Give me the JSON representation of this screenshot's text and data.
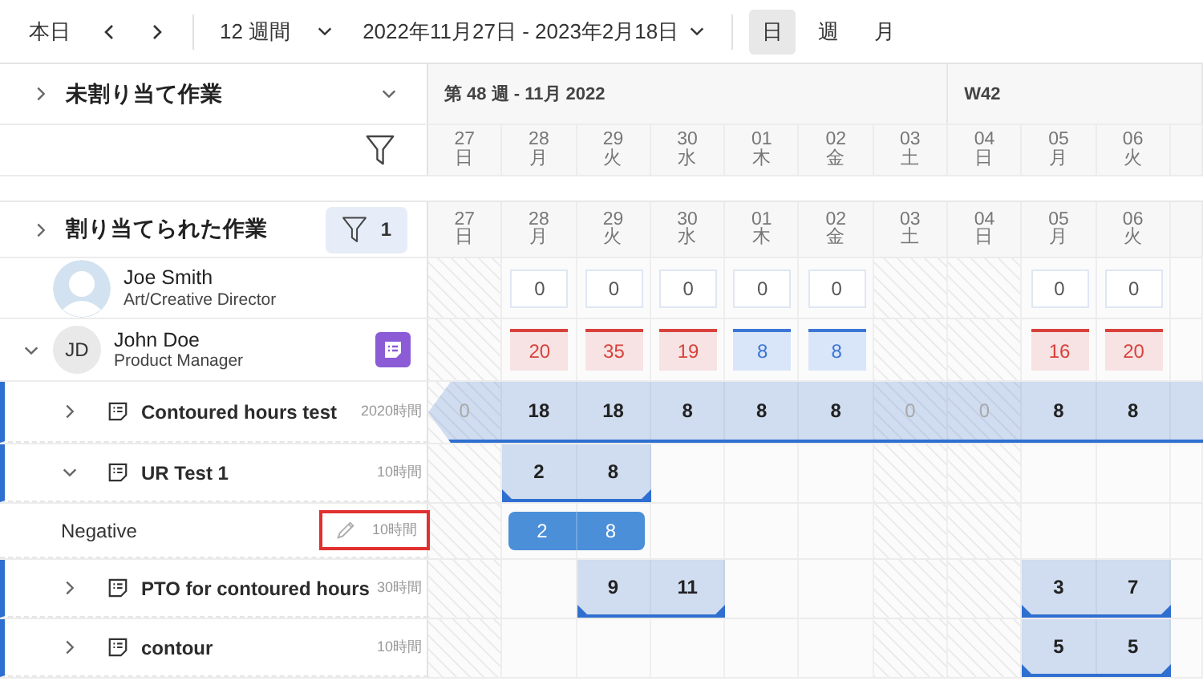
{
  "toolbar": {
    "today": "本日",
    "range": "12 週間",
    "dates": "2022年11月27日 - 2023年2月18日",
    "views": [
      {
        "label": "日",
        "selected": true
      },
      {
        "label": "週",
        "selected": false
      },
      {
        "label": "月",
        "selected": false
      }
    ]
  },
  "unassigned": {
    "label": "未割り当て作業",
    "expanded": false
  },
  "weeks": [
    {
      "label": "第 48 週 - 11月 2022",
      "days": [
        {
          "date": "27",
          "weekday": "日",
          "weekend": true
        },
        {
          "date": "28",
          "weekday": "月",
          "weekend": false
        },
        {
          "date": "29",
          "weekday": "火",
          "weekend": false
        },
        {
          "date": "30",
          "weekday": "水",
          "weekend": false
        },
        {
          "date": "01",
          "weekday": "木",
          "weekend": false
        },
        {
          "date": "02",
          "weekday": "金",
          "weekend": false
        },
        {
          "date": "03",
          "weekday": "土",
          "weekend": true
        }
      ]
    },
    {
      "label": "W42",
      "days": [
        {
          "date": "04",
          "weekday": "日",
          "weekend": true
        },
        {
          "date": "05",
          "weekday": "月",
          "weekend": false
        },
        {
          "date": "06",
          "weekday": "火",
          "weekend": false
        }
      ]
    }
  ],
  "assigned": {
    "label": "割り当てられた作業",
    "expanded": false,
    "filter_count": "1",
    "days": [
      {
        "date": "27",
        "weekday": "日"
      },
      {
        "date": "28",
        "weekday": "月"
      },
      {
        "date": "29",
        "weekday": "火"
      },
      {
        "date": "30",
        "weekday": "水"
      },
      {
        "date": "01",
        "weekday": "木"
      },
      {
        "date": "02",
        "weekday": "金"
      },
      {
        "date": "03",
        "weekday": "土"
      },
      {
        "date": "04",
        "weekday": "日"
      },
      {
        "date": "05",
        "weekday": "月"
      },
      {
        "date": "06",
        "weekday": "火"
      }
    ]
  },
  "rows": [
    {
      "kind": "person",
      "name": "Joe Smith",
      "role": "Art/Creative Director",
      "cells": [
        null,
        {
          "value": "0"
        },
        {
          "value": "0"
        },
        {
          "value": "0"
        },
        {
          "value": "0"
        },
        {
          "value": "0"
        },
        null,
        null,
        {
          "value": "0"
        },
        {
          "value": "0"
        }
      ]
    },
    {
      "kind": "person",
      "name": "John Doe",
      "role": "Product Manager",
      "initials": "JD",
      "expanded": true,
      "note_icon": true,
      "cells": [
        null,
        {
          "value": "20",
          "over": true
        },
        {
          "value": "35",
          "over": true
        },
        {
          "value": "19",
          "over": true
        },
        {
          "value": "8",
          "over": false
        },
        {
          "value": "8",
          "over": false
        },
        null,
        null,
        {
          "value": "16",
          "over": true
        },
        {
          "value": "20",
          "over": true
        }
      ]
    },
    {
      "kind": "task",
      "name": "Contoured hours test",
      "hours": "2020時間",
      "expanded": false,
      "continues_left": true,
      "continues_right": true,
      "cells": [
        "0",
        "18",
        "18",
        "8",
        "8",
        "8",
        "0",
        "0",
        "8",
        "8"
      ]
    },
    {
      "kind": "task",
      "name": "UR Test 1",
      "hours": "10時間",
      "expanded": true,
      "cells": [
        null,
        "2",
        "8",
        null,
        null,
        null,
        null,
        null,
        null,
        null
      ]
    },
    {
      "kind": "subtask",
      "name": "Negative",
      "hours": "10時間",
      "highlighted": true,
      "cells": [
        null,
        "2",
        "8",
        null,
        null,
        null,
        null,
        null,
        null,
        null
      ]
    },
    {
      "kind": "task",
      "name": "PTO for contoured hours",
      "hours": "30時間",
      "expanded": false,
      "cells": [
        null,
        null,
        "9",
        "11",
        null,
        null,
        null,
        null,
        "3",
        "7"
      ]
    },
    {
      "kind": "task",
      "name": "contour",
      "hours": "10時間",
      "expanded": false,
      "cells": [
        null,
        null,
        null,
        null,
        null,
        null,
        null,
        null,
        "5",
        "5"
      ]
    }
  ]
}
